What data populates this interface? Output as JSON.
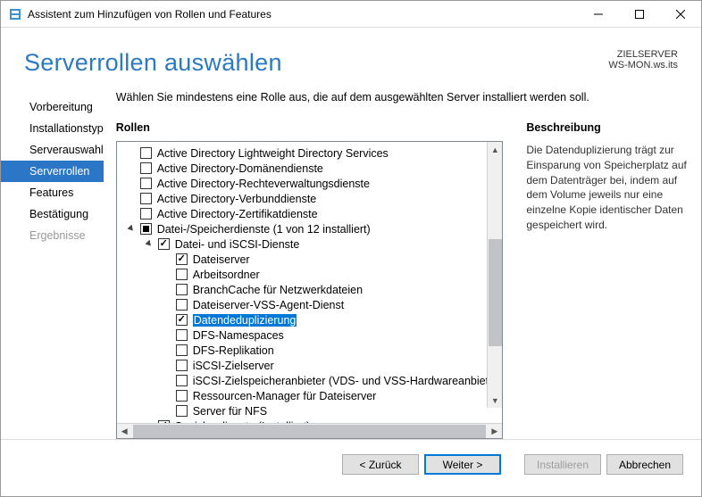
{
  "window": {
    "title": "Assistent zum Hinzufügen von Rollen und Features"
  },
  "header": {
    "title": "Serverrollen auswählen",
    "target_label": "ZIELSERVER",
    "target_value": "WS-MON.ws.its"
  },
  "sidebar": {
    "items": [
      {
        "label": "Vorbereitung",
        "state": "normal"
      },
      {
        "label": "Installationstyp",
        "state": "normal"
      },
      {
        "label": "Serverauswahl",
        "state": "normal"
      },
      {
        "label": "Serverrollen",
        "state": "selected"
      },
      {
        "label": "Features",
        "state": "normal"
      },
      {
        "label": "Bestätigung",
        "state": "normal"
      },
      {
        "label": "Ergebnisse",
        "state": "disabled"
      }
    ]
  },
  "main": {
    "intro": "Wählen Sie mindestens eine Rolle aus, die auf dem ausgewählten Server installiert werden soll.",
    "roles_header": "Rollen",
    "desc_header": "Beschreibung",
    "description": "Die Datenduplizierung trägt zur Einsparung von Speicherplatz auf dem Datenträger bei, indem auf dem Volume jeweils nur eine einzelne Kopie identischer Daten gespeichert wird.",
    "tree": [
      {
        "indent": 0,
        "expander": "",
        "check": "unchecked",
        "label": "Active Directory Lightweight Directory Services"
      },
      {
        "indent": 0,
        "expander": "",
        "check": "unchecked",
        "label": "Active Directory-Domänendienste"
      },
      {
        "indent": 0,
        "expander": "",
        "check": "unchecked",
        "label": "Active Directory-Rechteverwaltungsdienste"
      },
      {
        "indent": 0,
        "expander": "",
        "check": "unchecked",
        "label": "Active Directory-Verbunddienste"
      },
      {
        "indent": 0,
        "expander": "",
        "check": "unchecked",
        "label": "Active Directory-Zertifikatdienste"
      },
      {
        "indent": 0,
        "expander": "open",
        "check": "partial",
        "label": "Datei-/Speicherdienste (1 von 12 installiert)"
      },
      {
        "indent": 1,
        "expander": "open",
        "check": "checked",
        "label": "Datei- und iSCSI-Dienste"
      },
      {
        "indent": 2,
        "expander": "",
        "check": "checked",
        "label": "Dateiserver"
      },
      {
        "indent": 2,
        "expander": "",
        "check": "unchecked",
        "label": "Arbeitsordner"
      },
      {
        "indent": 2,
        "expander": "",
        "check": "unchecked",
        "label": "BranchCache für Netzwerkdateien"
      },
      {
        "indent": 2,
        "expander": "",
        "check": "unchecked",
        "label": "Dateiserver-VSS-Agent-Dienst"
      },
      {
        "indent": 2,
        "expander": "",
        "check": "checked",
        "label": "Datendeduplizierung",
        "selected": true
      },
      {
        "indent": 2,
        "expander": "",
        "check": "unchecked",
        "label": "DFS-Namespaces"
      },
      {
        "indent": 2,
        "expander": "",
        "check": "unchecked",
        "label": "DFS-Replikation"
      },
      {
        "indent": 2,
        "expander": "",
        "check": "unchecked",
        "label": "iSCSI-Zielserver"
      },
      {
        "indent": 2,
        "expander": "",
        "check": "unchecked",
        "label": "iSCSI-Zielspeicheranbieter (VDS- und VSS-Hardwareanbieter)"
      },
      {
        "indent": 2,
        "expander": "",
        "check": "unchecked",
        "label": "Ressourcen-Manager für Dateiserver"
      },
      {
        "indent": 2,
        "expander": "",
        "check": "unchecked",
        "label": "Server für NFS"
      },
      {
        "indent": 1,
        "expander": "",
        "check": "checked",
        "label": "Speicherdienste (Installiert)"
      }
    ]
  },
  "footer": {
    "back": "< Zurück",
    "next": "Weiter >",
    "install": "Installieren",
    "cancel": "Abbrechen"
  }
}
